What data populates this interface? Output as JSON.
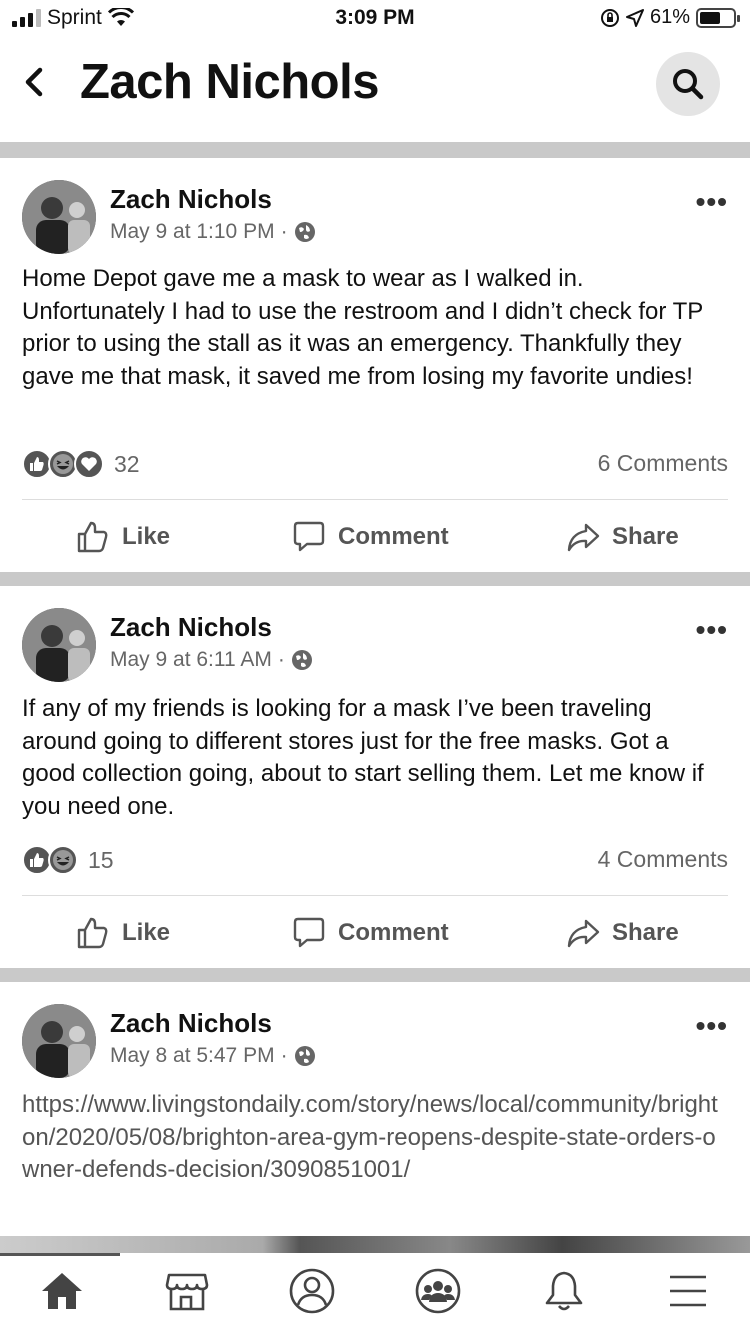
{
  "status_bar": {
    "carrier": "Sprint",
    "time": "3:09 PM",
    "battery": "61%",
    "battery_level": 0.61
  },
  "header": {
    "title": "Zach Nichols",
    "back_icon": "chevron-left-icon",
    "search_icon": "search-icon"
  },
  "posts": [
    {
      "author": "Zach Nichols",
      "date": "May 9 at 1:10 PM",
      "privacy_icon": "globe-icon",
      "text": "Home Depot gave me a mask to wear as I walked in. Unfortunately I had to use the restroom and I didn’t check for TP prior to using the stall as it was an emergency. Thankfully they gave me that mask, it saved me from losing my favorite undies!",
      "reactions": [
        "like-icon",
        "haha-icon",
        "love-icon"
      ],
      "reaction_count": "32",
      "comments": "6 Comments"
    },
    {
      "author": "Zach Nichols",
      "date": "May 9 at 6:11 AM",
      "privacy_icon": "globe-icon",
      "text": "If any of my friends is looking for a mask I’ve been traveling around going to different stores just for the free masks. Got a good collection going, about to start selling them. Let me know if you need one.",
      "reactions": [
        "like-icon",
        "haha-icon"
      ],
      "reaction_count": "15",
      "comments": "4 Comments"
    },
    {
      "author": "Zach Nichols",
      "date": "May 8 at 5:47 PM",
      "privacy_icon": "globe-icon",
      "text": "https://www.livingstondaily.com/story/news/local/community/brighton/2020/05/08/brighton-area-gym-reopens-despite-state-orders-owner-defends-decision/3090851001/"
    }
  ],
  "actions": {
    "like": "Like",
    "comment": "Comment",
    "share": "Share"
  },
  "more_label": "•••",
  "separator_dot": "·",
  "tabs": [
    "home-icon",
    "marketplace-icon",
    "profile-icon",
    "groups-icon",
    "notifications-icon",
    "menu-icon"
  ]
}
